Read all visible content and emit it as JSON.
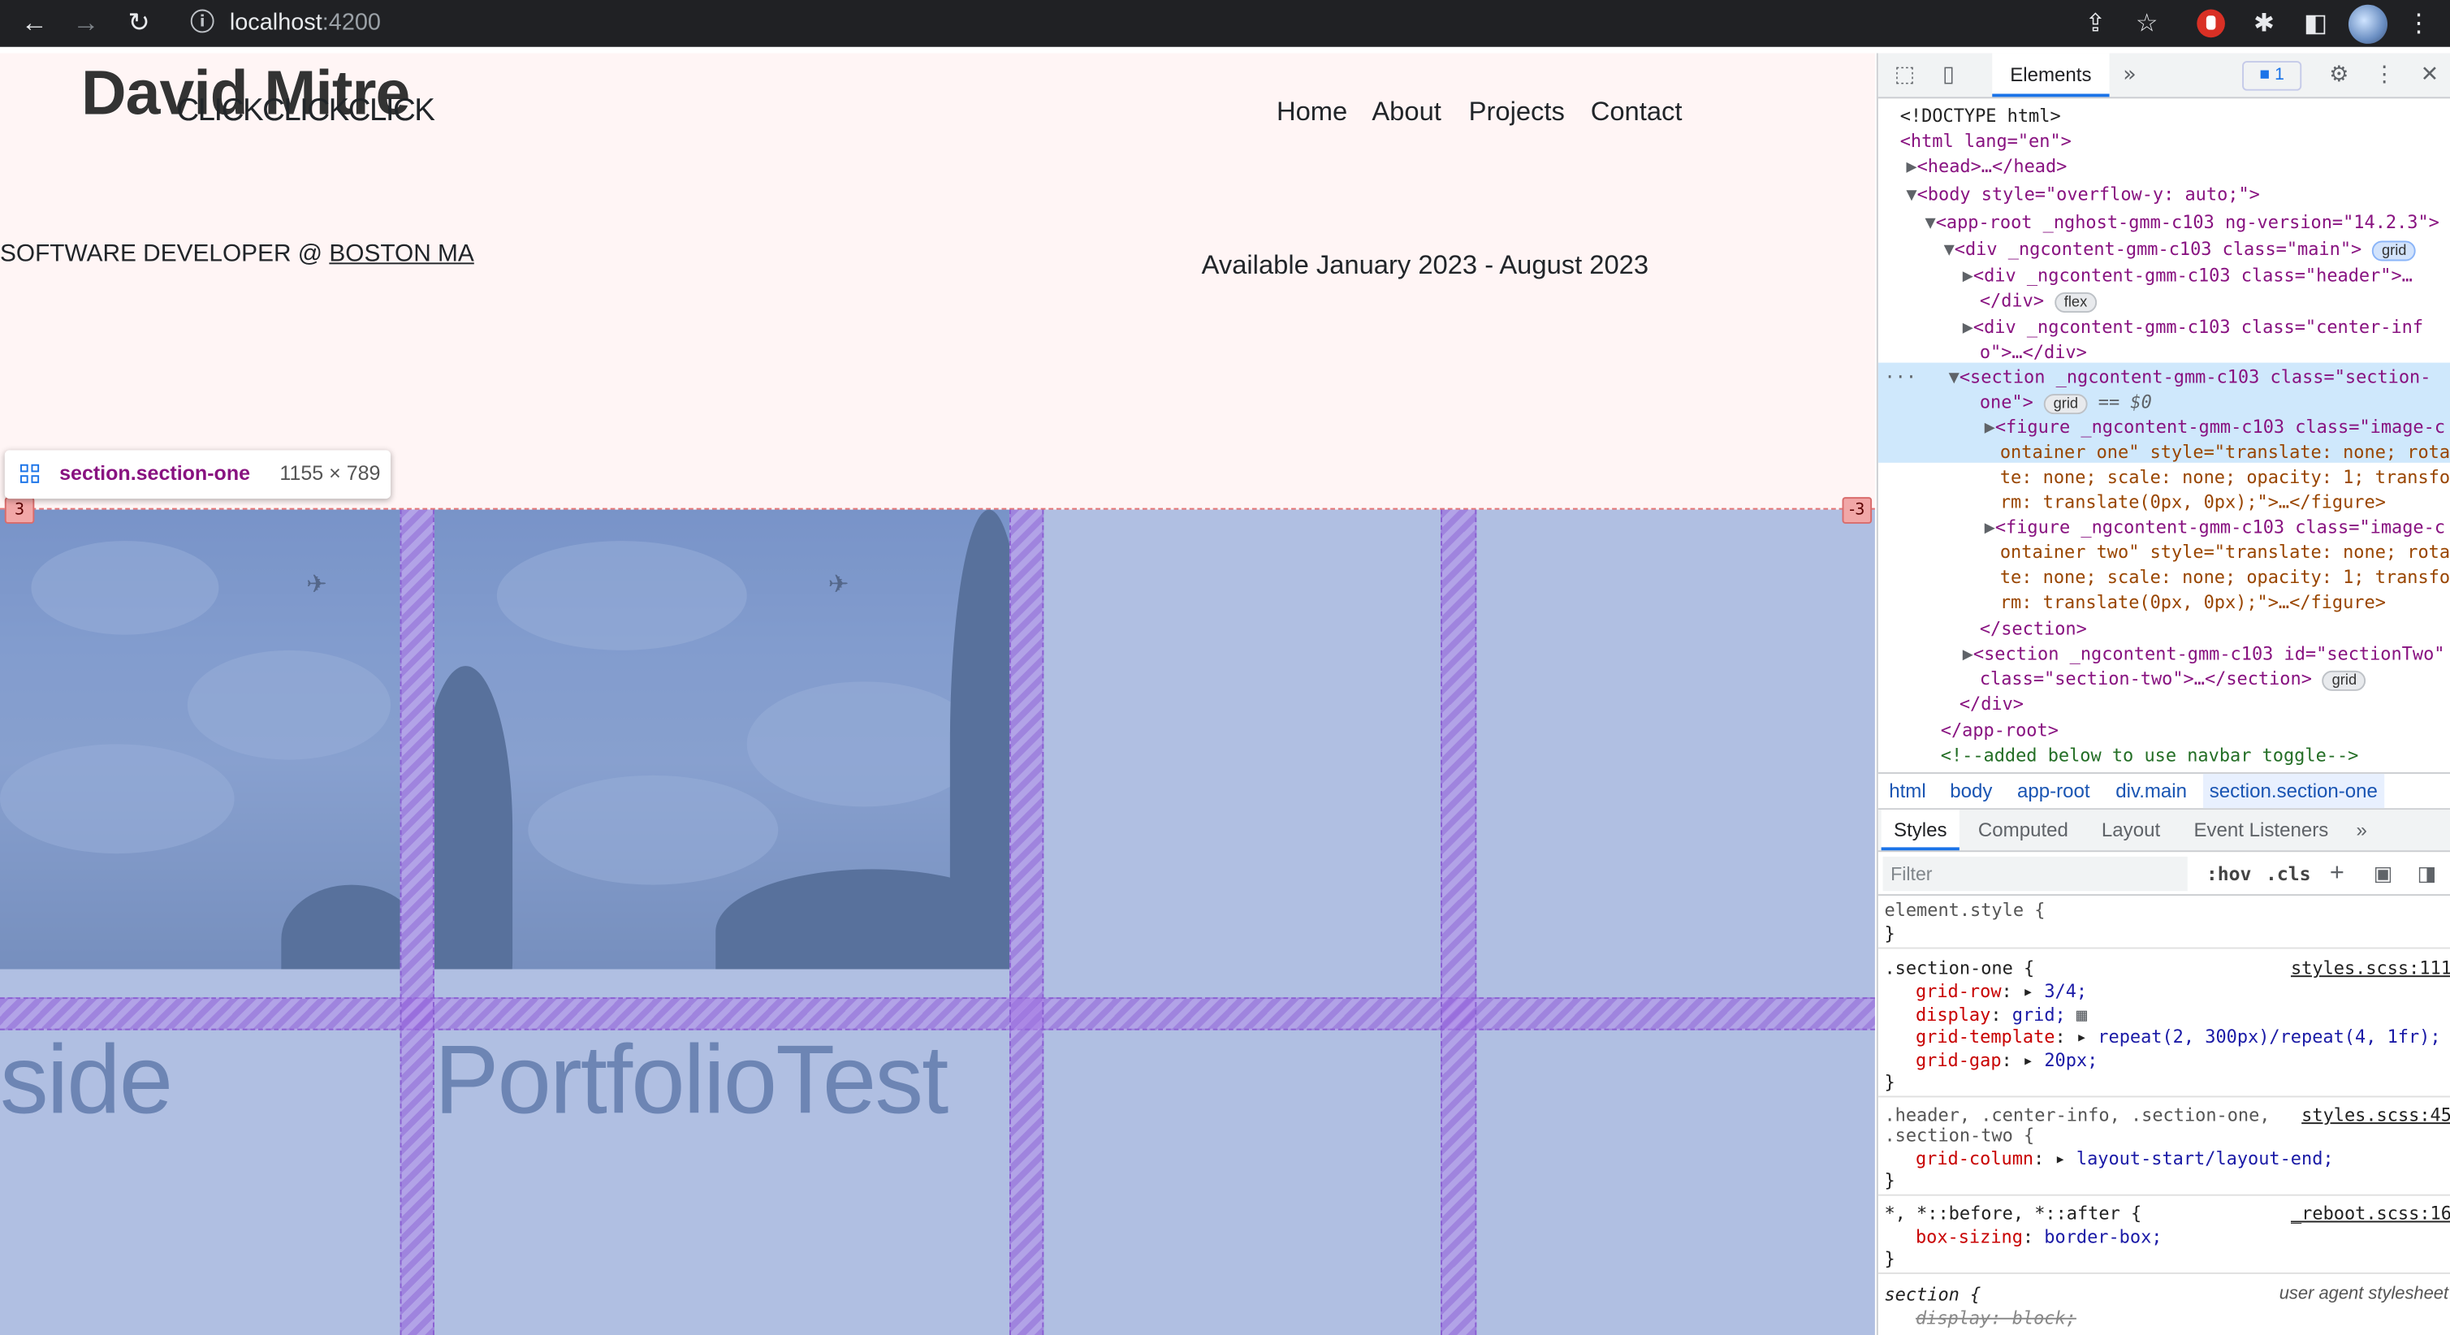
{
  "browser": {
    "host": "localhost",
    "port": ":4200"
  },
  "site": {
    "title": "David Mitre",
    "click_text": "CLICKCLICKCLICK",
    "nav": [
      "Home",
      "About",
      "Projects",
      "Contact"
    ],
    "role_prefix": "SOFTWARE DEVELOPER @ ",
    "role_location": "BOSTON MA",
    "availability": "Available January 2023 - August 2023",
    "caption_left": "side",
    "caption_main": "PortfolioTest"
  },
  "inspector": {
    "tooltip_name": "section.section-one",
    "tooltip_size": "1155 × 789",
    "badge_left": "3",
    "badge_right": "-3"
  },
  "devtools": {
    "tab_elements": "Elements",
    "issues_count": "1",
    "dom": [
      "<!DOCTYPE html>",
      "<html lang=\"en\">",
      "<head>…</head>",
      "<body style=\"overflow-y: auto;\">",
      "<app-root _nghost-gmm-c103 ng-version=\"14.2.3\">",
      "<div _ngcontent-gmm-c103 class=\"main\">",
      "<div _ngcontent-gmm-c103 class=\"header\">…",
      "</div>",
      "<div _ngcontent-gmm-c103 class=\"center-inf",
      "o\">…</div>",
      "<section _ngcontent-gmm-c103 class=\"section-",
      "one\">",
      "<figure _ngcontent-gmm-c103 class=\"image-c",
      "ontainer one\" style=\"translate: none; rota",
      "te: none; scale: none; opacity: 1; transfo",
      "rm: translate(0px, 0px);\">…</figure>",
      "<figure _ngcontent-gmm-c103 class=\"image-c",
      "ontainer two\" style=\"translate: none; rota",
      "te: none; scale: none; opacity: 1; transfo",
      "rm: translate(0px, 0px);\">…</figure>",
      "</section>",
      "<section _ngcontent-gmm-c103 id=\"sectionTwo\"",
      "class=\"section-two\">…</section>",
      "</div>",
      "</app-root>",
      "<!--added below to use navbar toggle-->"
    ],
    "pills": {
      "grid": "grid",
      "flex": "flex",
      "dollar0": "== $0"
    },
    "breadcrumbs": [
      "html",
      "body",
      "app-root",
      "div.main",
      "section.section-one"
    ],
    "style_tabs": [
      "Styles",
      "Computed",
      "Layout",
      "Event Listeners"
    ],
    "filter_placeholder": "Filter",
    "hov": ":hov",
    "cls": ".cls",
    "css": {
      "element_style": "element.style {",
      "close": "}",
      "r1_selector": ".section-one {",
      "r1_source": "styles.scss:111",
      "r1_props": [
        {
          "p": "grid-row",
          "v": "3/4;"
        },
        {
          "p": "display",
          "v": "grid;"
        },
        {
          "p": "grid-template",
          "v": "repeat(2, 300px)/repeat(4, 1fr);"
        },
        {
          "p": "grid-gap",
          "v": "20px;"
        }
      ],
      "r2_selector": ".header, .center-info, .section-one,",
      "r2_selector2": ".section-two {",
      "r2_source": "styles.scss:45",
      "r2_prop": "grid-column",
      "r2_val": "layout-start/layout-end;",
      "r3_selector": "*, *::before, *::after {",
      "r3_source": "_reboot.scss:16",
      "r3_prop": "box-sizing",
      "r3_val": "border-box;",
      "r4_selector": "section {",
      "r4_source": "user agent stylesheet",
      "r4_prop": "display: block;"
    }
  },
  "colors": {
    "page_bg": "#fff5f5",
    "grid_overlay": "#6f91d2",
    "grid_gap": "#9664dc",
    "devtools_selected": "#cfe8fc"
  }
}
